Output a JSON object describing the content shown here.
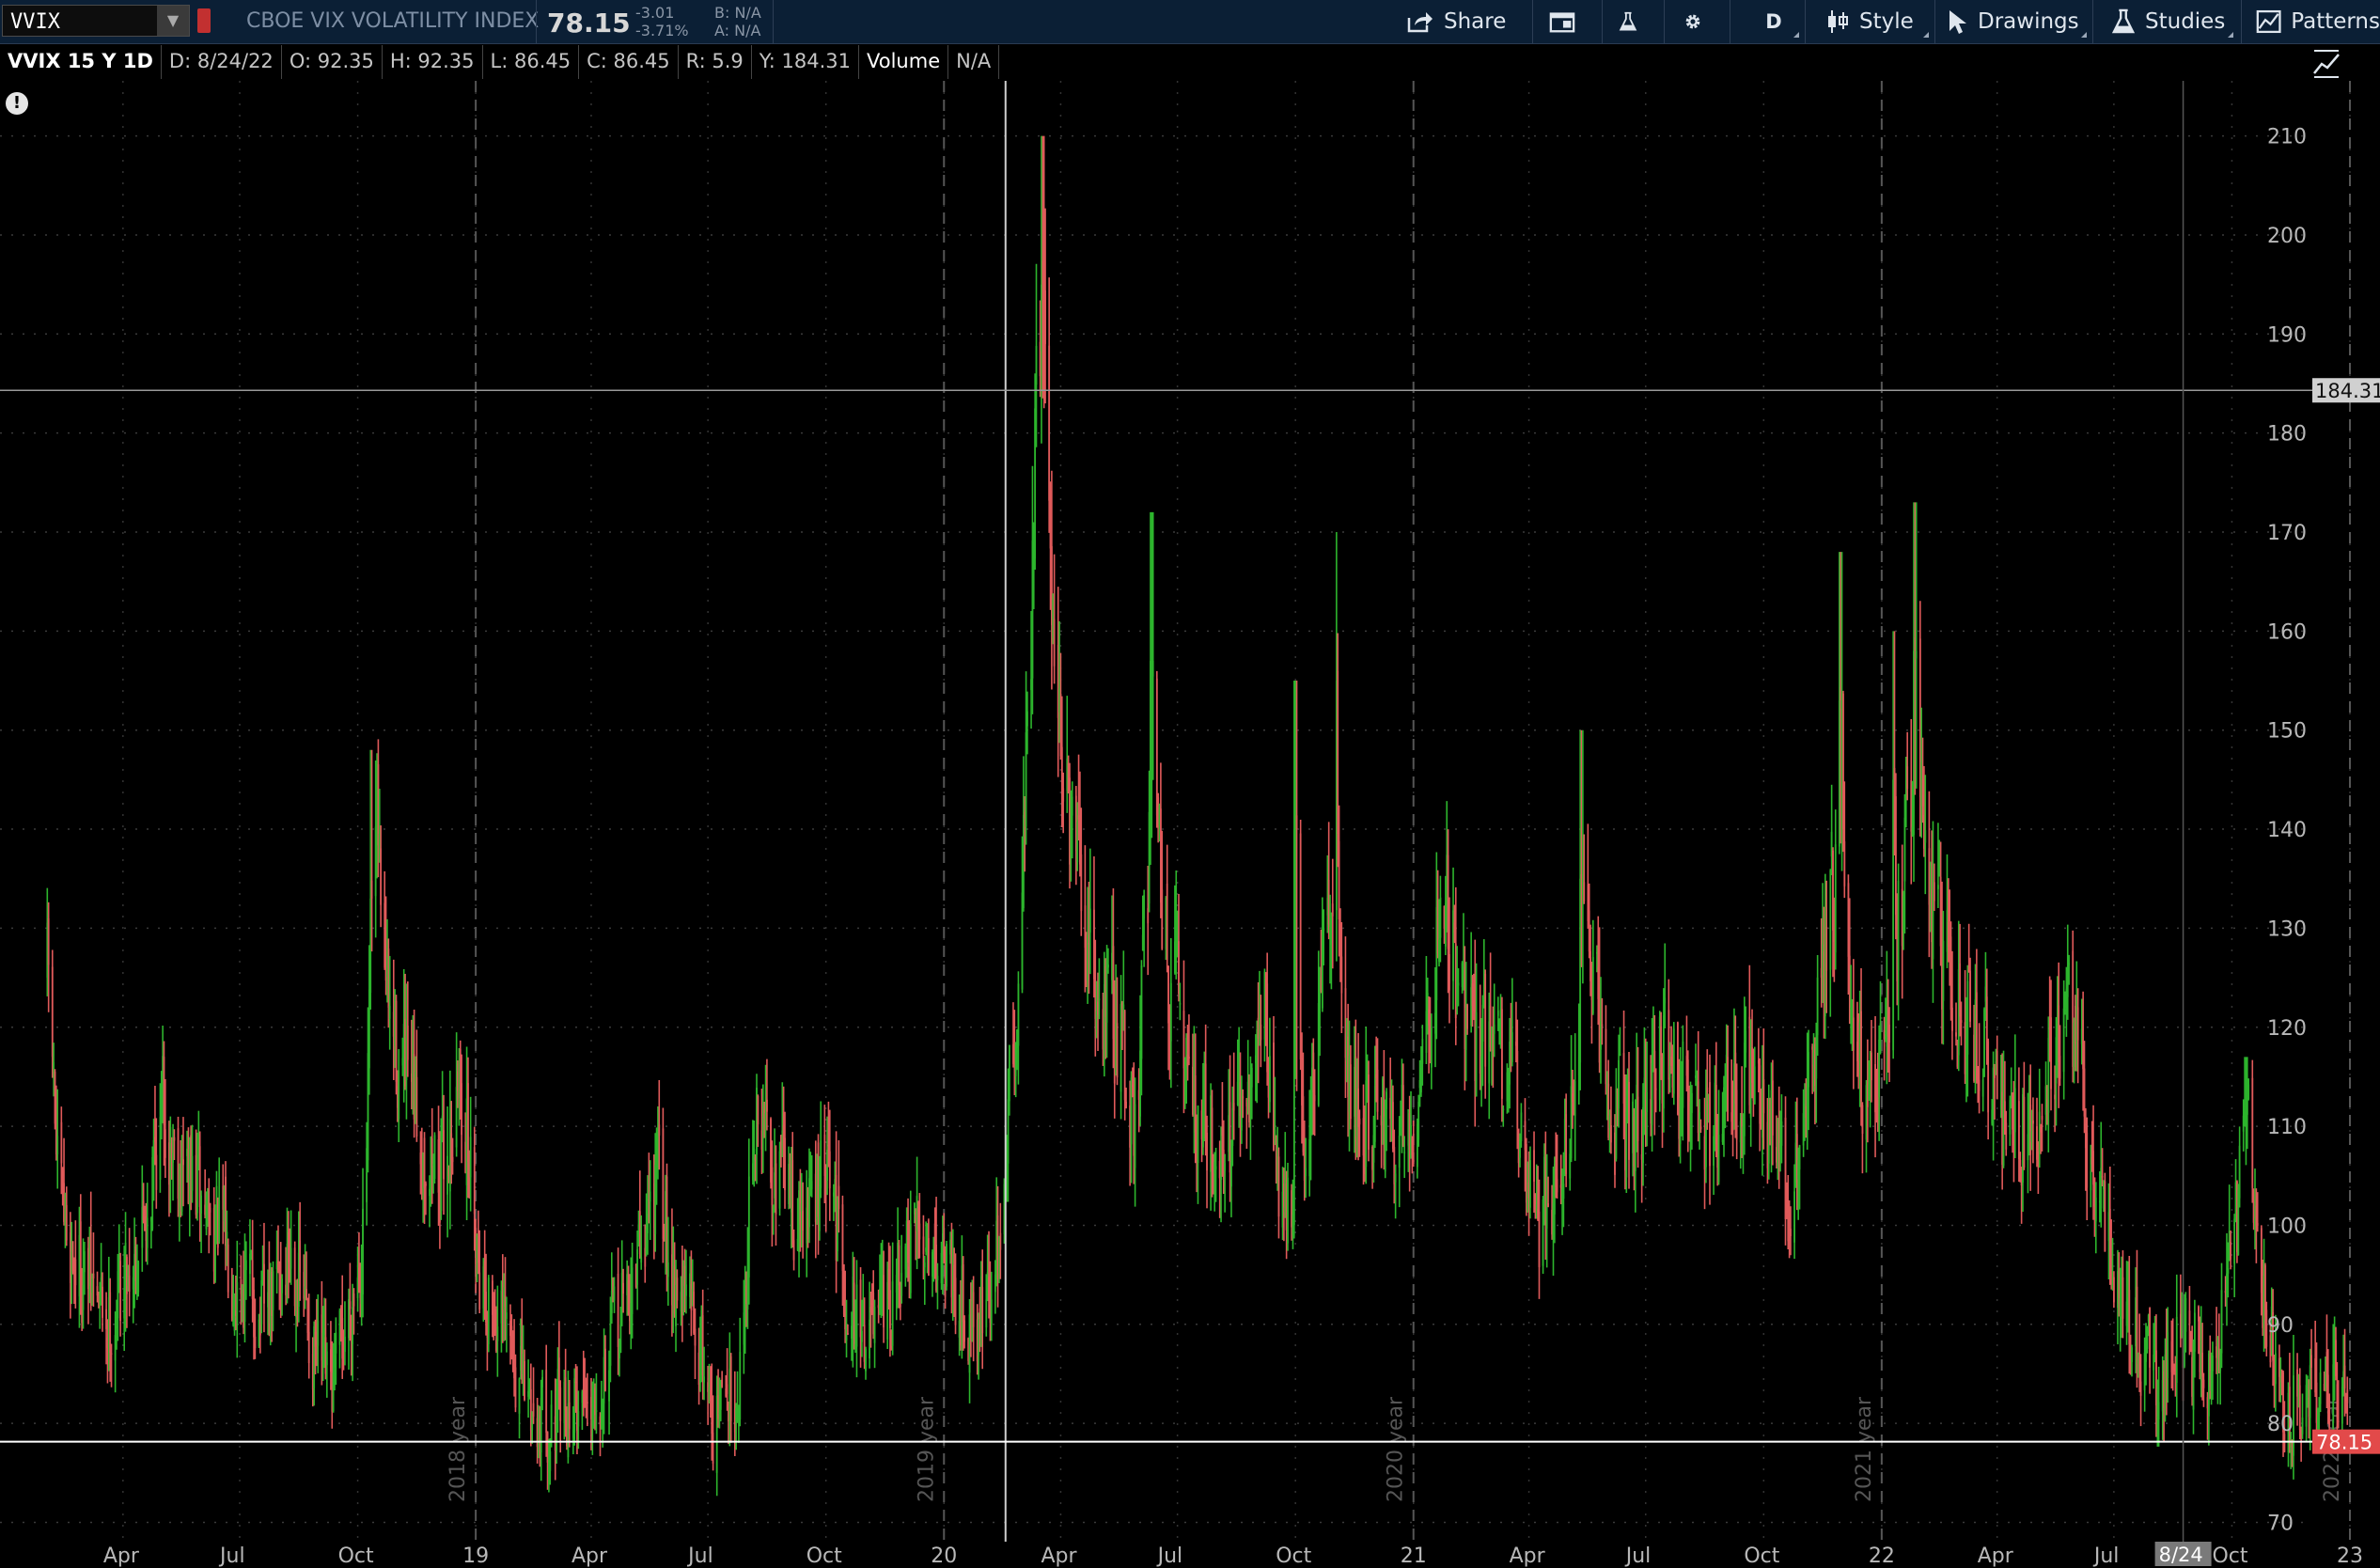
{
  "header": {
    "symbol": "VVIX",
    "company": "CBOE VIX VOLATILITY INDEX",
    "last": "78.15",
    "change": "-3.01",
    "change_pct": "-3.71%",
    "bid": "B: N/A",
    "ask": "A: N/A"
  },
  "toolbar": {
    "share": "Share",
    "aggregation": "D",
    "style": "Style",
    "drawings": "Drawings",
    "studies": "Studies",
    "patterns": "Patterns"
  },
  "infobar": {
    "title": "VVIX 15 Y 1D",
    "date": "D: 8/24/22",
    "open": "O: 92.35",
    "high": "H: 92.35",
    "low": "L: 86.45",
    "close": "C: 86.45",
    "range": "R: 5.9",
    "y": "Y: 184.31",
    "volume_label": "Volume",
    "volume_value": "N/A"
  },
  "colors": {
    "up": "#2db52d",
    "down": "#e05a5a",
    "background": "#000000",
    "toolbar": "#0b1f35"
  },
  "chart_data": {
    "type": "candlestick",
    "ylim": [
      70,
      215
    ],
    "y_ticks": [
      70,
      80,
      90,
      100,
      110,
      120,
      130,
      140,
      150,
      160,
      170,
      180,
      190,
      200,
      210
    ],
    "x_ticks": [
      "Apr",
      "Jul",
      "Oct",
      "19",
      "Apr",
      "Jul",
      "Oct",
      "20",
      "Apr",
      "Jul",
      "Oct",
      "21",
      "Apr",
      "Jul",
      "Oct",
      "22",
      "Apr",
      "Jul",
      "8/24",
      "Oct",
      "23"
    ],
    "year_labels": [
      "2018 year",
      "2019 year",
      "2020 year",
      "2021 year",
      "2022 year"
    ],
    "crosshair": {
      "date": "8/24",
      "y": "184.31"
    },
    "last_price": "78.15",
    "x_start": "2018-02-01",
    "x_end": "2022-12-31",
    "anchors": [
      [
        "2018-02-01",
        125
      ],
      [
        "2018-02-10",
        100
      ],
      [
        "2018-03-01",
        95
      ],
      [
        "2018-03-20",
        90
      ],
      [
        "2018-04-15",
        100
      ],
      [
        "2018-05-01",
        112
      ],
      [
        "2018-05-20",
        105
      ],
      [
        "2018-06-10",
        100
      ],
      [
        "2018-07-01",
        95
      ],
      [
        "2018-07-20",
        90
      ],
      [
        "2018-08-10",
        98
      ],
      [
        "2018-08-25",
        88
      ],
      [
        "2018-09-10",
        82
      ],
      [
        "2018-10-05",
        100
      ],
      [
        "2018-10-15",
        140
      ],
      [
        "2018-10-25",
        120
      ],
      [
        "2018-11-15",
        110
      ],
      [
        "2018-12-05",
        105
      ],
      [
        "2018-12-20",
        115
      ],
      [
        "2019-01-05",
        95
      ],
      [
        "2019-01-25",
        88
      ],
      [
        "2019-02-10",
        82
      ],
      [
        "2019-03-01",
        80
      ],
      [
        "2019-03-20",
        82
      ],
      [
        "2019-04-10",
        86
      ],
      [
        "2019-05-05",
        95
      ],
      [
        "2019-05-20",
        105
      ],
      [
        "2019-06-05",
        95
      ],
      [
        "2019-06-25",
        88
      ],
      [
        "2019-07-05",
        80
      ],
      [
        "2019-07-25",
        85
      ],
      [
        "2019-08-05",
        110
      ],
      [
        "2019-08-20",
        108
      ],
      [
        "2019-09-10",
        100
      ],
      [
        "2019-10-01",
        105
      ],
      [
        "2019-10-20",
        92
      ],
      [
        "2019-11-10",
        88
      ],
      [
        "2019-12-01",
        95
      ],
      [
        "2019-12-20",
        100
      ],
      [
        "2020-01-10",
        95
      ],
      [
        "2020-01-25",
        90
      ],
      [
        "2020-02-10",
        95
      ],
      [
        "2020-02-25",
        120
      ],
      [
        "2020-03-05",
        150
      ],
      [
        "2020-03-15",
        190
      ],
      [
        "2020-03-25",
        165
      ],
      [
        "2020-04-05",
        140
      ],
      [
        "2020-04-25",
        125
      ],
      [
        "2020-05-15",
        120
      ],
      [
        "2020-05-30",
        110
      ],
      [
        "2020-06-10",
        145
      ],
      [
        "2020-06-25",
        125
      ],
      [
        "2020-07-15",
        112
      ],
      [
        "2020-08-05",
        108
      ],
      [
        "2020-08-25",
        110
      ],
      [
        "2020-09-05",
        125
      ],
      [
        "2020-09-20",
        100
      ],
      [
        "2020-10-05",
        105
      ],
      [
        "2020-10-20",
        120
      ],
      [
        "2020-10-30",
        140
      ],
      [
        "2020-11-10",
        115
      ],
      [
        "2020-12-01",
        110
      ],
      [
        "2020-12-20",
        108
      ],
      [
        "2021-01-05",
        115
      ],
      [
        "2021-01-25",
        135
      ],
      [
        "2021-02-10",
        118
      ],
      [
        "2021-03-01",
        120
      ],
      [
        "2021-03-25",
        110
      ],
      [
        "2021-04-10",
        100
      ],
      [
        "2021-04-30",
        110
      ],
      [
        "2021-05-15",
        125
      ],
      [
        "2021-06-05",
        112
      ],
      [
        "2021-06-25",
        108
      ],
      [
        "2021-07-15",
        118
      ],
      [
        "2021-08-05",
        112
      ],
      [
        "2021-08-25",
        110
      ],
      [
        "2021-09-15",
        115
      ],
      [
        "2021-10-05",
        110
      ],
      [
        "2021-10-20",
        102
      ],
      [
        "2021-11-05",
        112
      ],
      [
        "2021-11-25",
        135
      ],
      [
        "2021-12-10",
        125
      ],
      [
        "2021-12-20",
        112
      ],
      [
        "2022-01-05",
        120
      ],
      [
        "2022-01-25",
        145
      ],
      [
        "2022-02-10",
        130
      ],
      [
        "2022-03-01",
        122
      ],
      [
        "2022-03-20",
        118
      ],
      [
        "2022-04-10",
        108
      ],
      [
        "2022-05-01",
        112
      ],
      [
        "2022-05-15",
        120
      ],
      [
        "2022-06-01",
        118
      ],
      [
        "2022-06-15",
        105
      ],
      [
        "2022-07-01",
        95
      ],
      [
        "2022-07-20",
        88
      ],
      [
        "2022-08-05",
        85
      ],
      [
        "2022-08-24",
        88
      ],
      [
        "2022-09-10",
        85
      ],
      [
        "2022-09-25",
        92
      ],
      [
        "2022-10-05",
        100
      ],
      [
        "2022-10-12",
        110
      ],
      [
        "2022-10-25",
        95
      ],
      [
        "2022-11-10",
        82
      ],
      [
        "2022-11-25",
        83
      ]
    ],
    "spikes": [
      [
        "2020-03-18",
        210
      ],
      [
        "2022-01-27",
        173
      ],
      [
        "2020-11-01",
        170
      ],
      [
        "2021-11-30",
        168
      ],
      [
        "2020-06-11",
        172
      ],
      [
        "2018-10-12",
        148
      ],
      [
        "2020-10-01",
        155
      ],
      [
        "2021-05-12",
        150
      ],
      [
        "2022-01-10",
        160
      ],
      [
        "2022-10-12",
        117
      ]
    ]
  }
}
